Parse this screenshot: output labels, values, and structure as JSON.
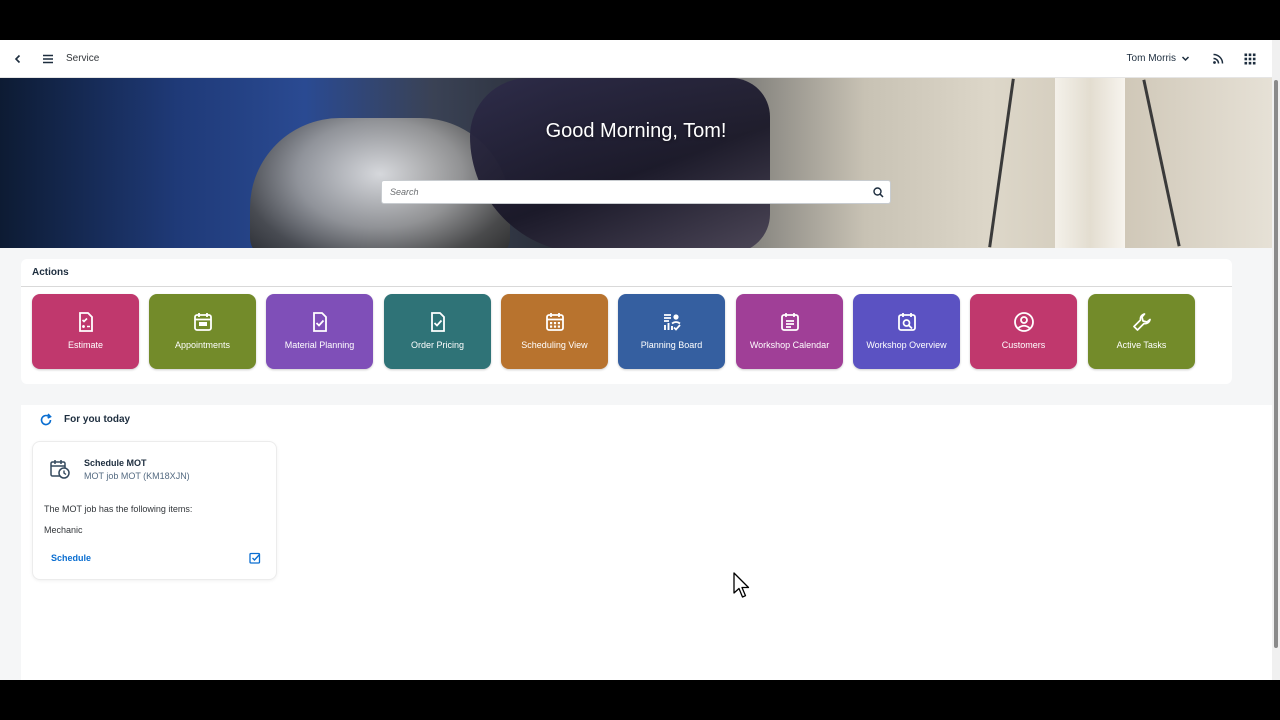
{
  "shell": {
    "app_title": "Service",
    "user_name": "Tom Morris"
  },
  "hero": {
    "greeting": "Good Morning, Tom!",
    "search_placeholder": "Search"
  },
  "actions": {
    "title": "Actions",
    "tiles": [
      {
        "label": "Estimate",
        "color": "#c0386d",
        "icon": "estimate-icon"
      },
      {
        "label": "Appointments",
        "color": "#738b2a",
        "icon": "calendar-icon"
      },
      {
        "label": "Material Planning",
        "color": "#7f4fb8",
        "icon": "document-check-icon"
      },
      {
        "label": "Order Pricing",
        "color": "#2f7377",
        "icon": "document-check-icon"
      },
      {
        "label": "Scheduling View",
        "color": "#b8732e",
        "icon": "calendar-icon"
      },
      {
        "label": "Planning Board",
        "color": "#355fa0",
        "icon": "planning-board-icon"
      },
      {
        "label": "Workshop Calendar",
        "color": "#a03f97",
        "icon": "calendar-list-icon"
      },
      {
        "label": "Workshop Overview",
        "color": "#5b52c2",
        "icon": "calendar-search-icon"
      },
      {
        "label": "Customers",
        "color": "#c0386d",
        "icon": "user-circle-icon"
      },
      {
        "label": "Active Tasks",
        "color": "#738b2a",
        "icon": "wrench-icon"
      }
    ]
  },
  "today": {
    "title": "For you today",
    "card": {
      "title": "Schedule MOT",
      "subtitle": "MOT job MOT (KM18XJN)",
      "text1": "The MOT job has the following items:",
      "text2": "Mechanic",
      "link": "Schedule"
    }
  }
}
